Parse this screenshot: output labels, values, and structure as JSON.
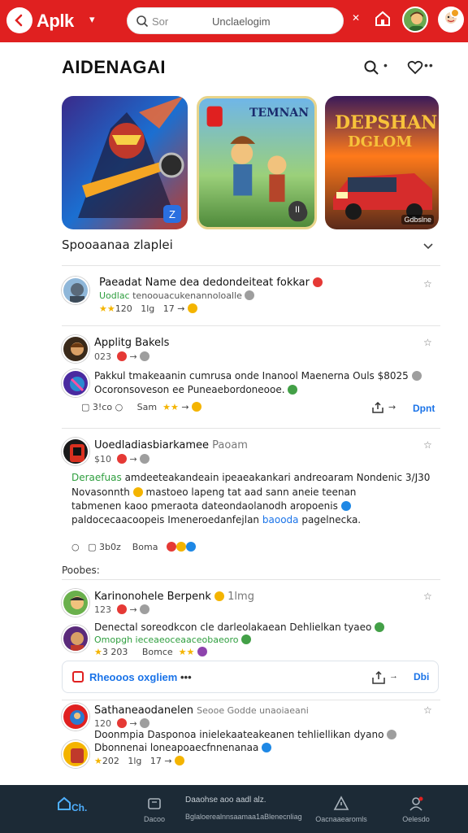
{
  "header": {
    "brand": "Aplk",
    "brand_caret": "▾",
    "search_placeholder_left": "Sor",
    "search_placeholder_right": "Unclaelogim",
    "close_mark": "✕"
  },
  "page": {
    "title": "AIDENAGAI",
    "title_dot": "•",
    "title_more": "••"
  },
  "featured": {
    "card1_badge": "Z",
    "card2_logo": "TEMNAN",
    "card2_badge": "II",
    "card3_logo_top": "DEPSHAN",
    "card3_logo_bottom": "DGLOM",
    "card3_tag": "Gdbslne"
  },
  "section_label": "Spooaanaa zlaplei",
  "feed": {
    "item1": {
      "title": "Paeadat Name dea dedondeiteat fokkar",
      "sub_green": "Uodlac",
      "sub_rest": "tenoouacukenannoloalle",
      "meta_rating": "120",
      "meta_count": "1lg",
      "meta_reply": "17 →"
    },
    "item2": {
      "title": "Applitg Bakels",
      "sub": "023",
      "meta_sep": "→",
      "star": "☆"
    },
    "item2b": {
      "line1": "Pakkul tmakeaanin cumrusa onde Inanool Maenernа Ouls $8025",
      "line2": "Ocoronsoveson ee Puneaebordoneooe.",
      "meta_left": "3!co",
      "meta_mid": "Sam",
      "link": "Dpnt"
    },
    "item3": {
      "title": "Uoedladiasbiarkamee",
      "title_grey": "Paoam",
      "sub": "$10",
      "body_green": "Deraefuas",
      "body1": "amdeeteakandeain ipeaeakankari andreoaram Nondenic 3/J30",
      "body2": "Novasonnth",
      "body2b": "mastoeo lapeng tat aad sann aneie teenan",
      "body3": "tabmenen kaoo pmeraota dateondaolanodh aropoenis",
      "body4": "paldocecaacoopeis Imeneroedanfejlan",
      "body4_blue": "baooda",
      "body4b": "pagelnecka.",
      "meta_left": "3b0z",
      "meta_mid": "Boma"
    },
    "group_label": "Poobes:",
    "item4": {
      "title": "Karinonohele Berpenk",
      "title_grey": "1lmg",
      "sub": "123"
    },
    "item4b": {
      "line1": "Denectal soreodkcon cle darleolakaean Dehlielkan tyaeo",
      "line2": "Omopgh ieceaeoceaaceobaeoro",
      "meta_left": "3 203",
      "meta_mid": "Bomce"
    },
    "cta": {
      "label": "Rheooos oxgliem",
      "dots": "•••",
      "right_dots": "→",
      "right_link": "Dbi"
    },
    "item5": {
      "title": "Sathaneaodanelen",
      "title_grey": "Seooe Godde unaoiaeani",
      "sub": "120"
    },
    "item5b": {
      "line1": "Doonmpia Dasponoa inielekaateakeanen tehliellikan dyano",
      "line2": "Dbonnenai loneapoaecfnnenanaa",
      "meta_rating": "202",
      "meta_count": "1lg",
      "meta_reply": "17 →"
    }
  },
  "bottom_nav": {
    "home_label": "Ch.",
    "item2_label": "Dacoo",
    "center_top": "Daaohse aoo aadl alz.",
    "center_bottom": "Bglaloerealnnsaamaa1aBlenecnliag",
    "item4_label": "Oacnaaearomls",
    "item5_label": "Oelesdo"
  },
  "colors": {
    "brand_red": "#e02020",
    "nav_bg": "#1c2a36",
    "link_blue": "#1a73e8",
    "green": "#2e9e3e"
  }
}
